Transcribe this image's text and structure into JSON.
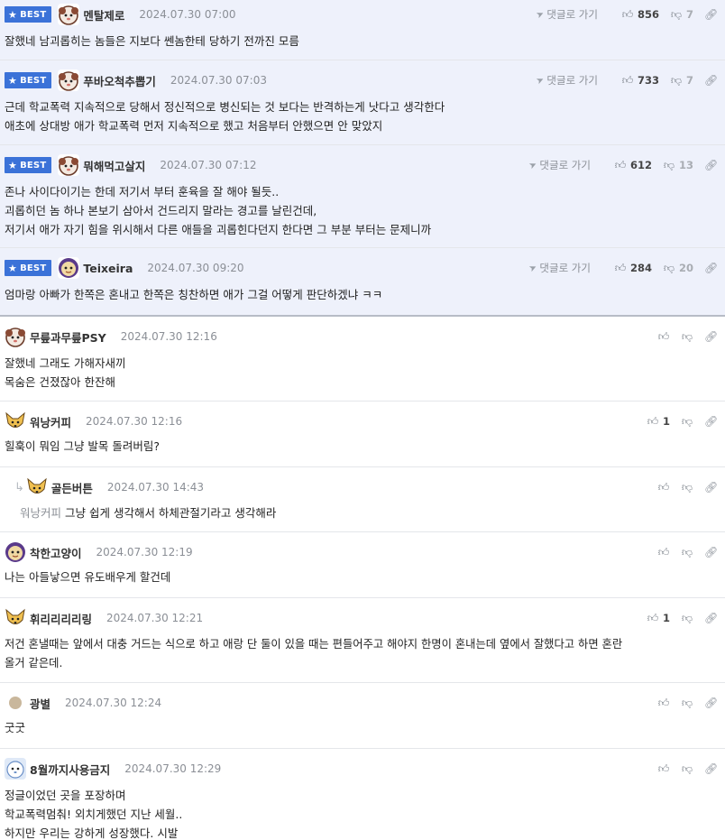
{
  "best_label": "BEST",
  "goto_label": "댓글로 가기",
  "best_comments": [
    {
      "nick": "멘탈제로",
      "date": "2024.07.30 07:00",
      "up": "856",
      "down": "7",
      "lines": [
        "잘했네 남괴롭히는 놈들은 지보다 쎈놈한테 당하기 전까진 모름"
      ]
    },
    {
      "nick": "푸바오척추뽑기",
      "date": "2024.07.30 07:03",
      "up": "733",
      "down": "7",
      "lines": [
        "근데 학교폭력 지속적으로 당해서 정신적으로 병신되는 것 보다는 반격하는게 낫다고 생각한다",
        "애초에 상대방 애가 학교폭력 먼저 지속적으로 했고 처음부터 안했으면 안 맞았지"
      ]
    },
    {
      "nick": "뭐해먹고살지",
      "date": "2024.07.30 07:12",
      "up": "612",
      "down": "13",
      "lines": [
        "존나 사이다이기는 한데 저기서 부터 훈육을 잘 해야 될듯..",
        "괴롭히던 놈 하나 본보기 삼아서 건드리지 말라는 경고를 날린건데,",
        "저기서 애가 자기 힘을 위시해서 다른 애들을 괴롭힌다던지 한다면 그 부분 부터는 문제니까"
      ]
    },
    {
      "nick": "Teixeira",
      "date": "2024.07.30 09:20",
      "up": "284",
      "down": "20",
      "lines": [
        "엄마랑 아빠가 한쪽은 혼내고 한쪽은 칭찬하면 애가 그걸 어떻게 판단하겠냐 ㅋㅋ"
      ]
    }
  ],
  "comments": [
    {
      "nick": "무릎과무릎PSY",
      "date": "2024.07.30 12:16",
      "up": "",
      "lines": [
        "잘했네 그래도 가해자새끼",
        "목숨은 건졌잖아 한잔해"
      ]
    },
    {
      "nick": "워낭커피",
      "date": "2024.07.30 12:16",
      "up": "1",
      "lines": [
        "힐훅이 뭐임 그냥 발목 돌려버림?"
      ]
    },
    {
      "nick": "골든버튼",
      "date": "2024.07.30 14:43",
      "up": "",
      "reply_to": "워낭커피",
      "lines": [
        "그냥 쉽게 생각해서 하체관절기라고 생각해라"
      ]
    },
    {
      "nick": "착한고양이",
      "date": "2024.07.30 12:19",
      "up": "",
      "lines": [
        "나는 아들낳으면 유도배우게 할건데"
      ]
    },
    {
      "nick": "휘리리리리링",
      "date": "2024.07.30 12:21",
      "up": "1",
      "lines": [
        "저건 혼낼때는 앞에서 대충 거드는 식으로 하고 애랑 단 둘이 있을 때는 편들어주고 해야지 한명이 혼내는데 옆에서 잘했다고 하면 혼란",
        "올거 같은데."
      ]
    },
    {
      "nick": "광별",
      "date": "2024.07.30 12:24",
      "up": "",
      "lines": [
        "굿굿"
      ]
    },
    {
      "nick": "8월까지사용금지",
      "date": "2024.07.30 12:29",
      "up": "",
      "lines": [
        "정글이었던 곳을 포장하며",
        "학교폭력멈춰! 외치게했던 지난 세월..",
        "하지만 우리는 강하게 성장했다. 시발"
      ]
    }
  ]
}
